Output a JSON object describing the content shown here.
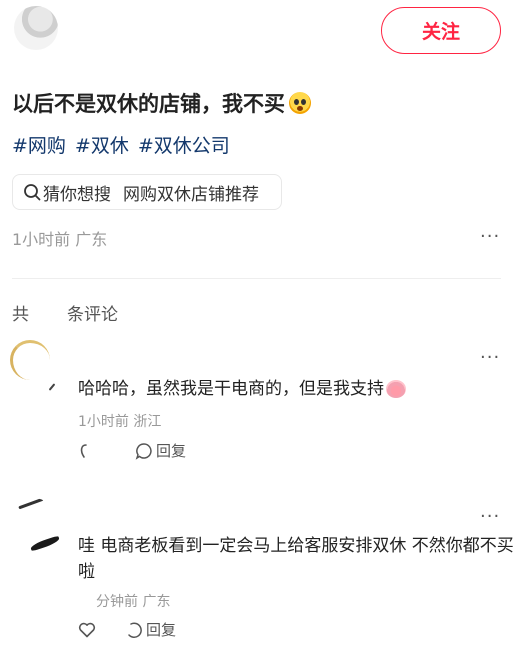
{
  "header": {
    "follow_label": "关注"
  },
  "post": {
    "title": "以后不是双休的店铺，我不买",
    "tags": [
      "#网购",
      "#双休",
      "#双休公司"
    ],
    "search_chip": {
      "prefix": "猜你想搜",
      "query": "网购双休店铺推荐"
    },
    "meta": "1小时前 广东",
    "more_label": "···"
  },
  "comments_section": {
    "count_prefix": "共",
    "count_suffix": "条评论"
  },
  "comments": [
    {
      "text": "哈哈哈，虽然我是干电商的，但是我支持",
      "meta": "1小时前 浙江",
      "reply_label": "回复",
      "more_label": "···"
    },
    {
      "text": "哇 电商老板看到一定会马上给客服安排双休 不然你都不买啦",
      "meta": "分钟前 广东",
      "reply_label": "回复",
      "more_label": "···"
    }
  ],
  "colors": {
    "accent": "#ff2442",
    "tag": "#13386c",
    "muted": "#999999"
  },
  "icons": [
    "search-icon",
    "heart-icon",
    "comment-icon",
    "more-icon"
  ]
}
